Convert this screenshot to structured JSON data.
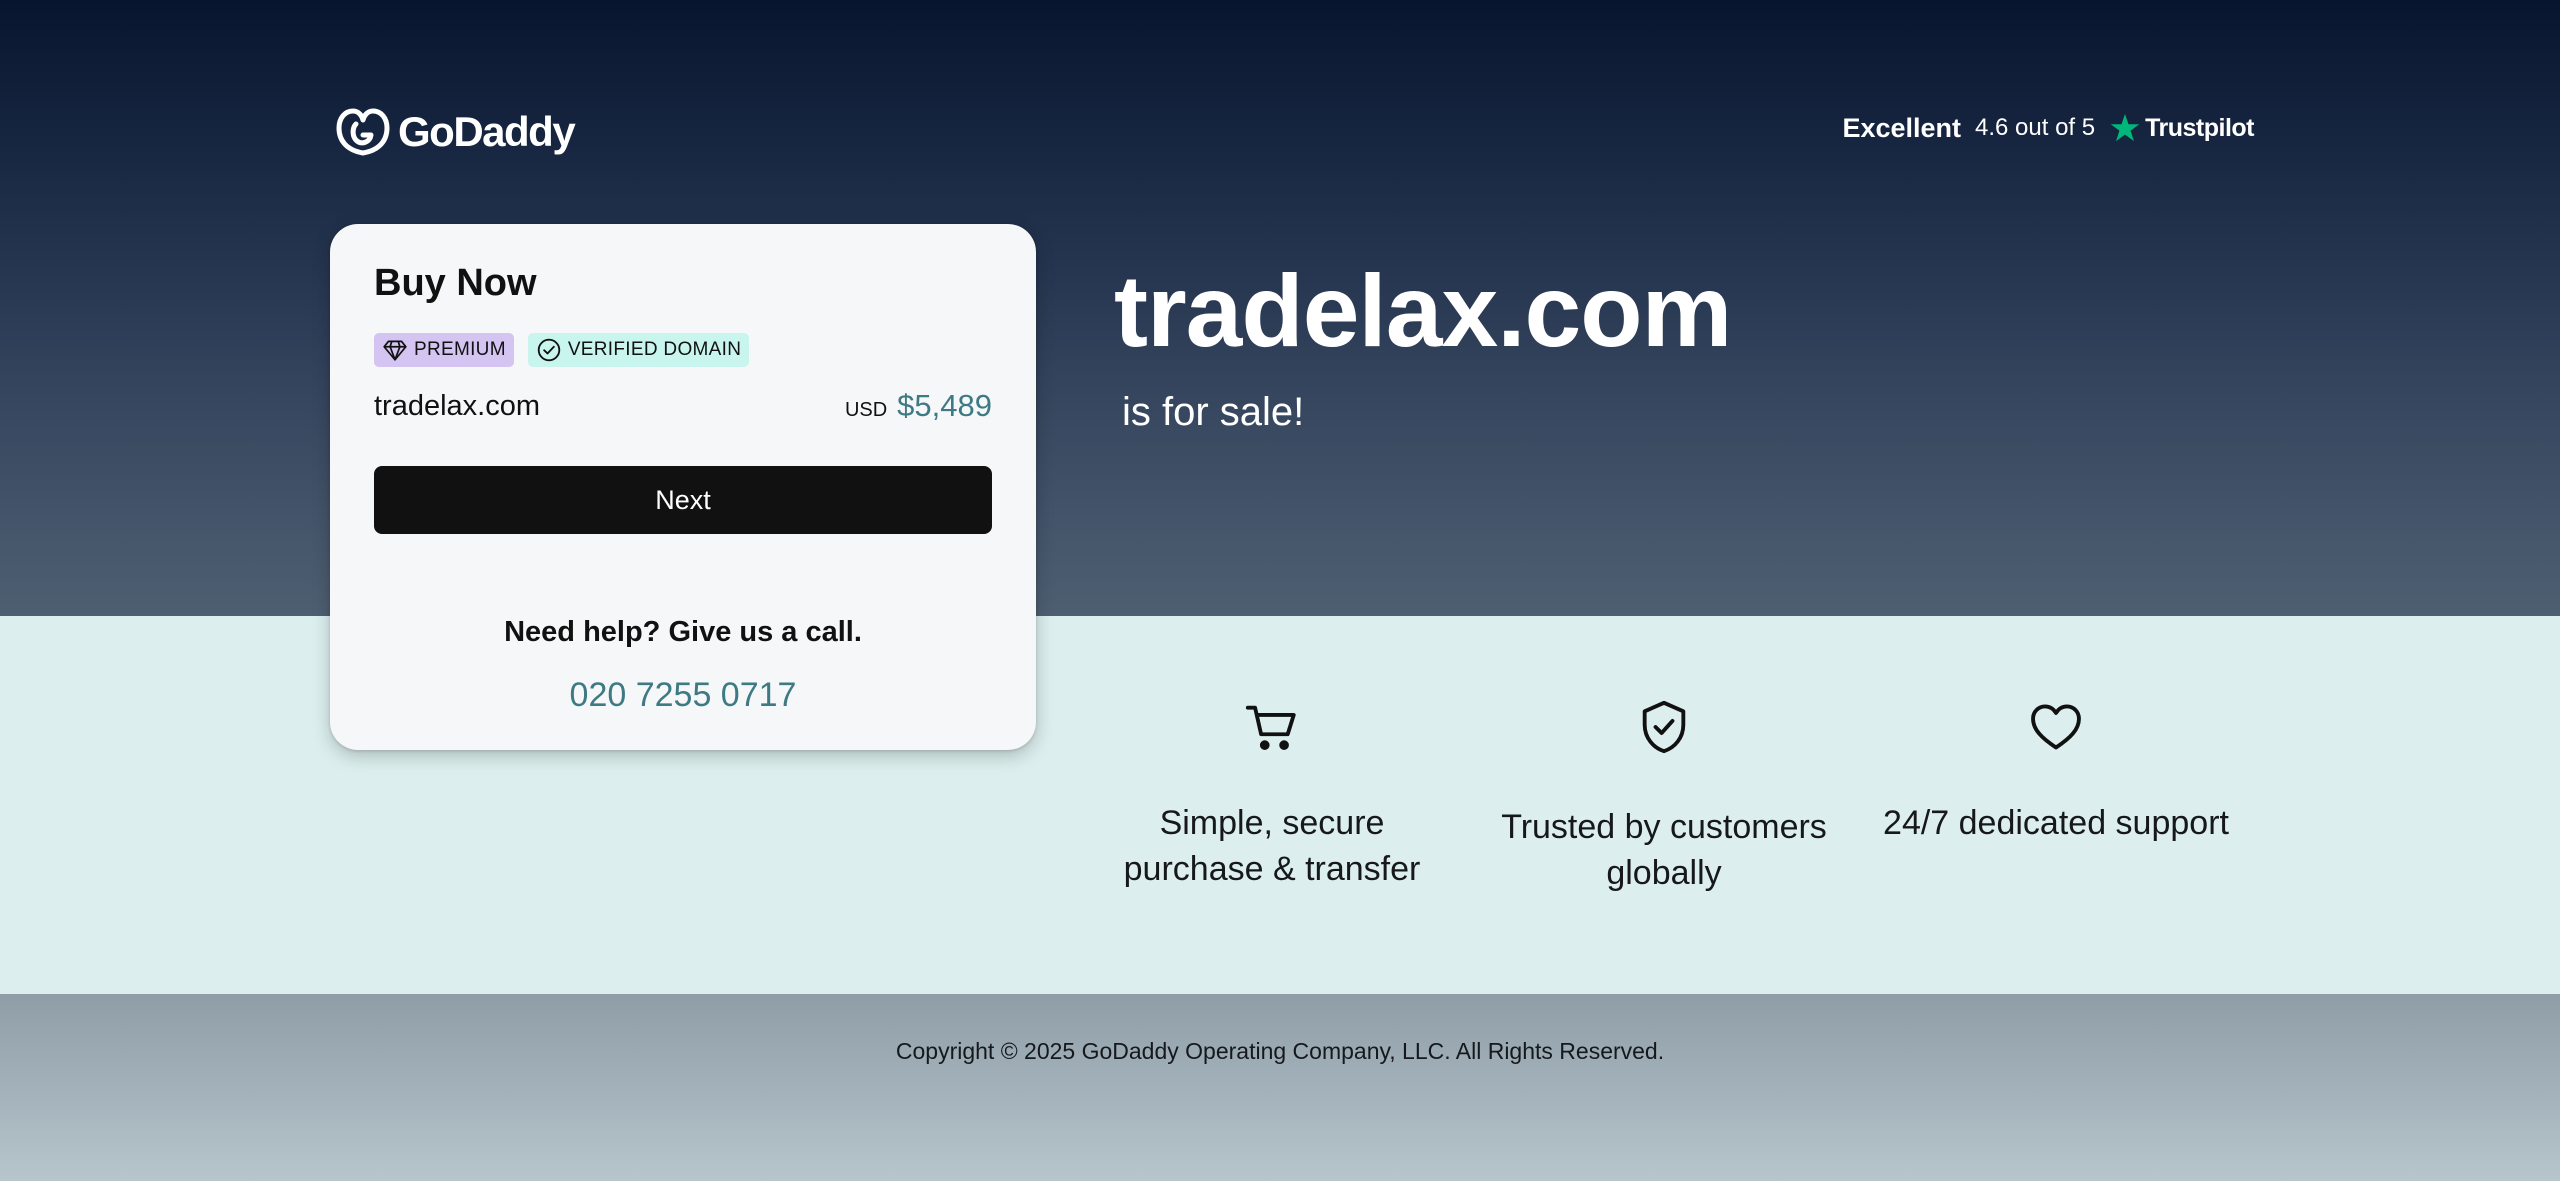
{
  "brand": {
    "name": "GoDaddy",
    "logo_icon": "godaddy-logo-icon"
  },
  "trustpilot": {
    "rating_word": "Excellent",
    "rating_text": "4.6 out of 5",
    "brand": "Trustpilot",
    "star_color": "#00b67a"
  },
  "hero": {
    "domain": "tradelax.com",
    "subtitle": "is for sale!"
  },
  "card": {
    "title": "Buy Now",
    "badges": [
      {
        "label": "PREMIUM",
        "icon": "diamond-icon",
        "color": "#d3c4f2"
      },
      {
        "label": "VERIFIED DOMAIN",
        "icon": "check-circle-icon",
        "color": "#c9f5ef"
      }
    ],
    "domain": "tradelax.com",
    "currency": "USD",
    "price": "$5,489",
    "next_label": "Next",
    "help_text": "Need help? Give us a call.",
    "phone": "020 7255 0717"
  },
  "features": [
    {
      "icon": "cart-icon",
      "label": "Simple, secure purchase & transfer"
    },
    {
      "icon": "shield-check-icon",
      "label": "Trusted by customers globally"
    },
    {
      "icon": "heart-icon",
      "label": "24/7 dedicated support"
    }
  ],
  "footer": {
    "copyright": "Copyright © 2025 GoDaddy Operating Company, LLC. All Rights Reserved."
  },
  "colors": {
    "accent_teal": "#3e7a84",
    "button_dark": "#111111",
    "band_bg": "#dcefee"
  }
}
